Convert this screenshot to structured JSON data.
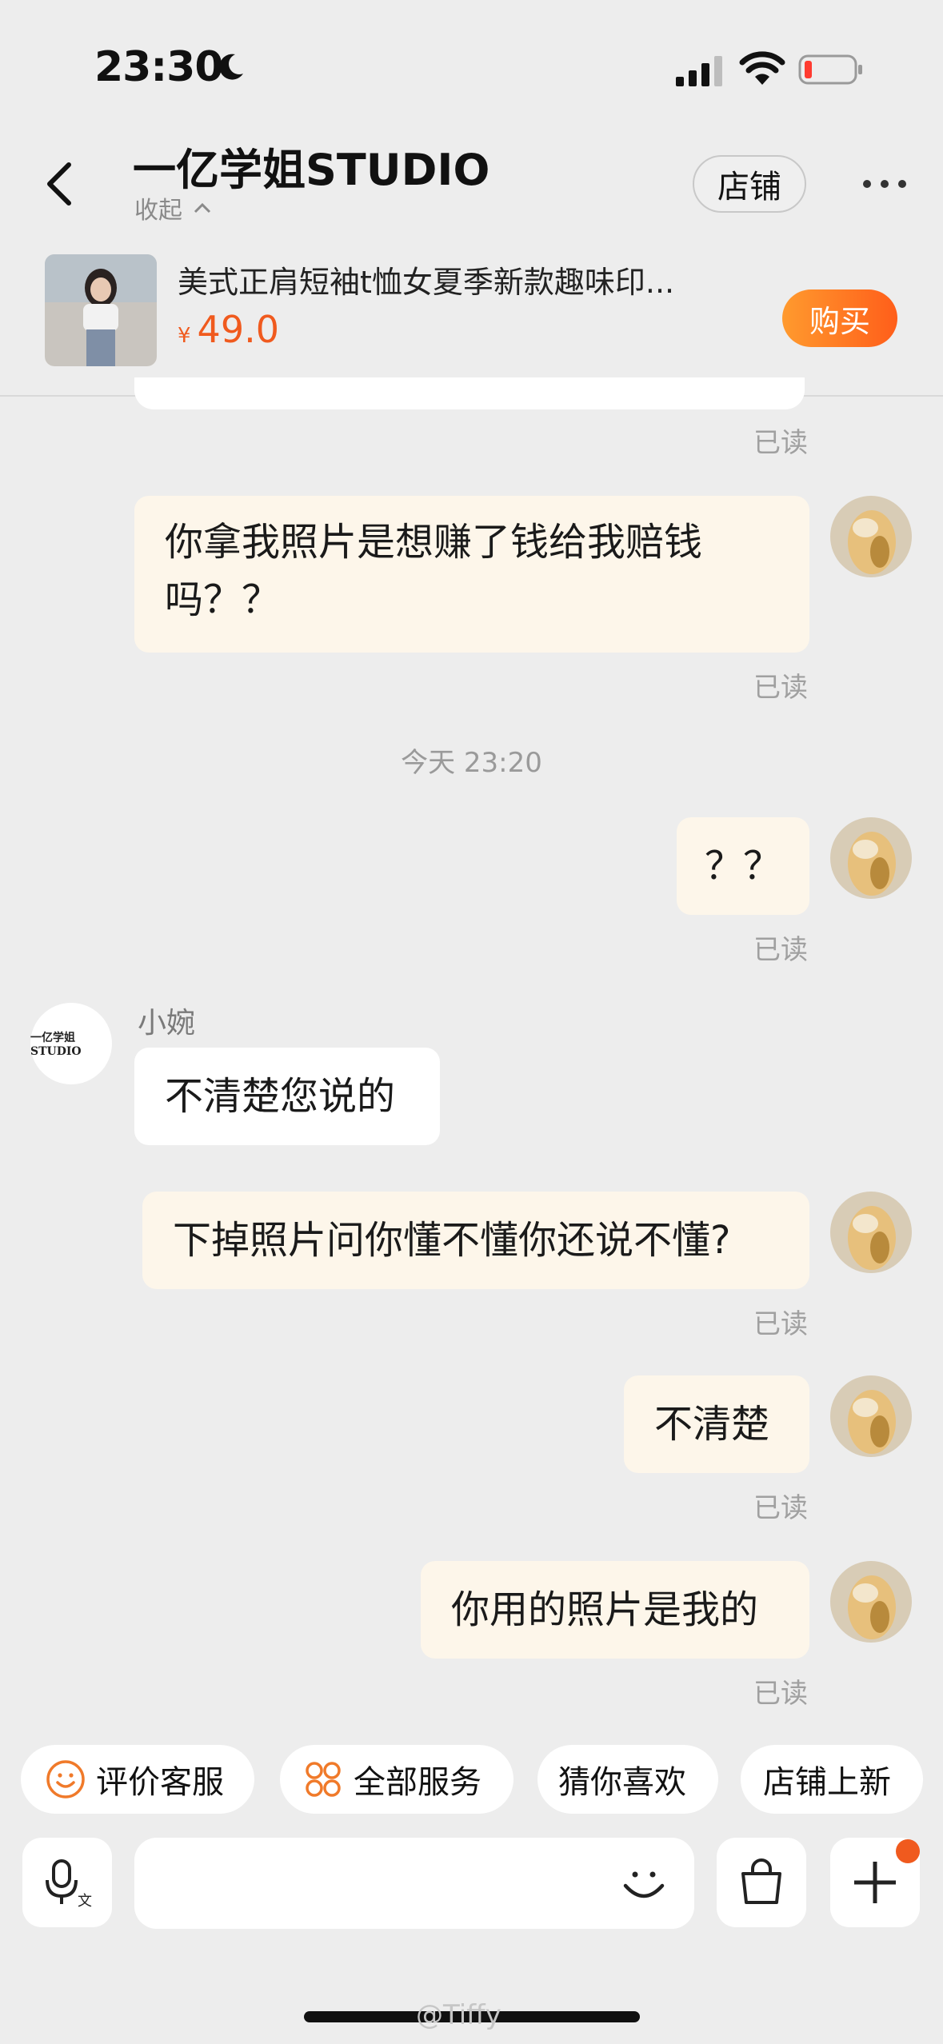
{
  "status_bar": {
    "time": "23:30"
  },
  "header": {
    "title": "一亿学姐STUDIO",
    "collapse_label": "收起",
    "store_button": "店铺"
  },
  "product": {
    "name": "美式正肩短袖t恤女夏季新款趣味印...",
    "currency": "¥",
    "price": "49.0",
    "buy_button": "购买"
  },
  "messages": [
    {
      "side": "right",
      "text": "",
      "status": "已读"
    },
    {
      "side": "right",
      "text": "你拿我照片是想赚了钱给我赔钱吗？？",
      "line1": "你拿我照片是想赚了钱给我赔钱",
      "line2": "吗？？",
      "status": "已读"
    },
    {
      "type": "timestamp",
      "text": "今天 23:20"
    },
    {
      "side": "right",
      "text": "？？",
      "status": "已读"
    },
    {
      "side": "left",
      "sender": "小婉",
      "text": "不清楚您说的"
    },
    {
      "side": "right",
      "text": "下掉照片问你懂不懂你还说不懂?",
      "status": "已读"
    },
    {
      "side": "right",
      "text": "不清楚",
      "status": "已读"
    },
    {
      "side": "right",
      "text": "你用的照片是我的",
      "status": "已读"
    }
  ],
  "shop_avatar_text": "一亿学姐STUDIO",
  "quick_actions": [
    "评价客服",
    "全部服务",
    "猜你喜欢",
    "店铺上新"
  ],
  "input_bar": {
    "placeholder": ""
  },
  "watermark": "@Tiffy",
  "colors": {
    "accent": "#f05a1e",
    "bubble_self": "#fdf6ea",
    "background": "#ededed"
  }
}
